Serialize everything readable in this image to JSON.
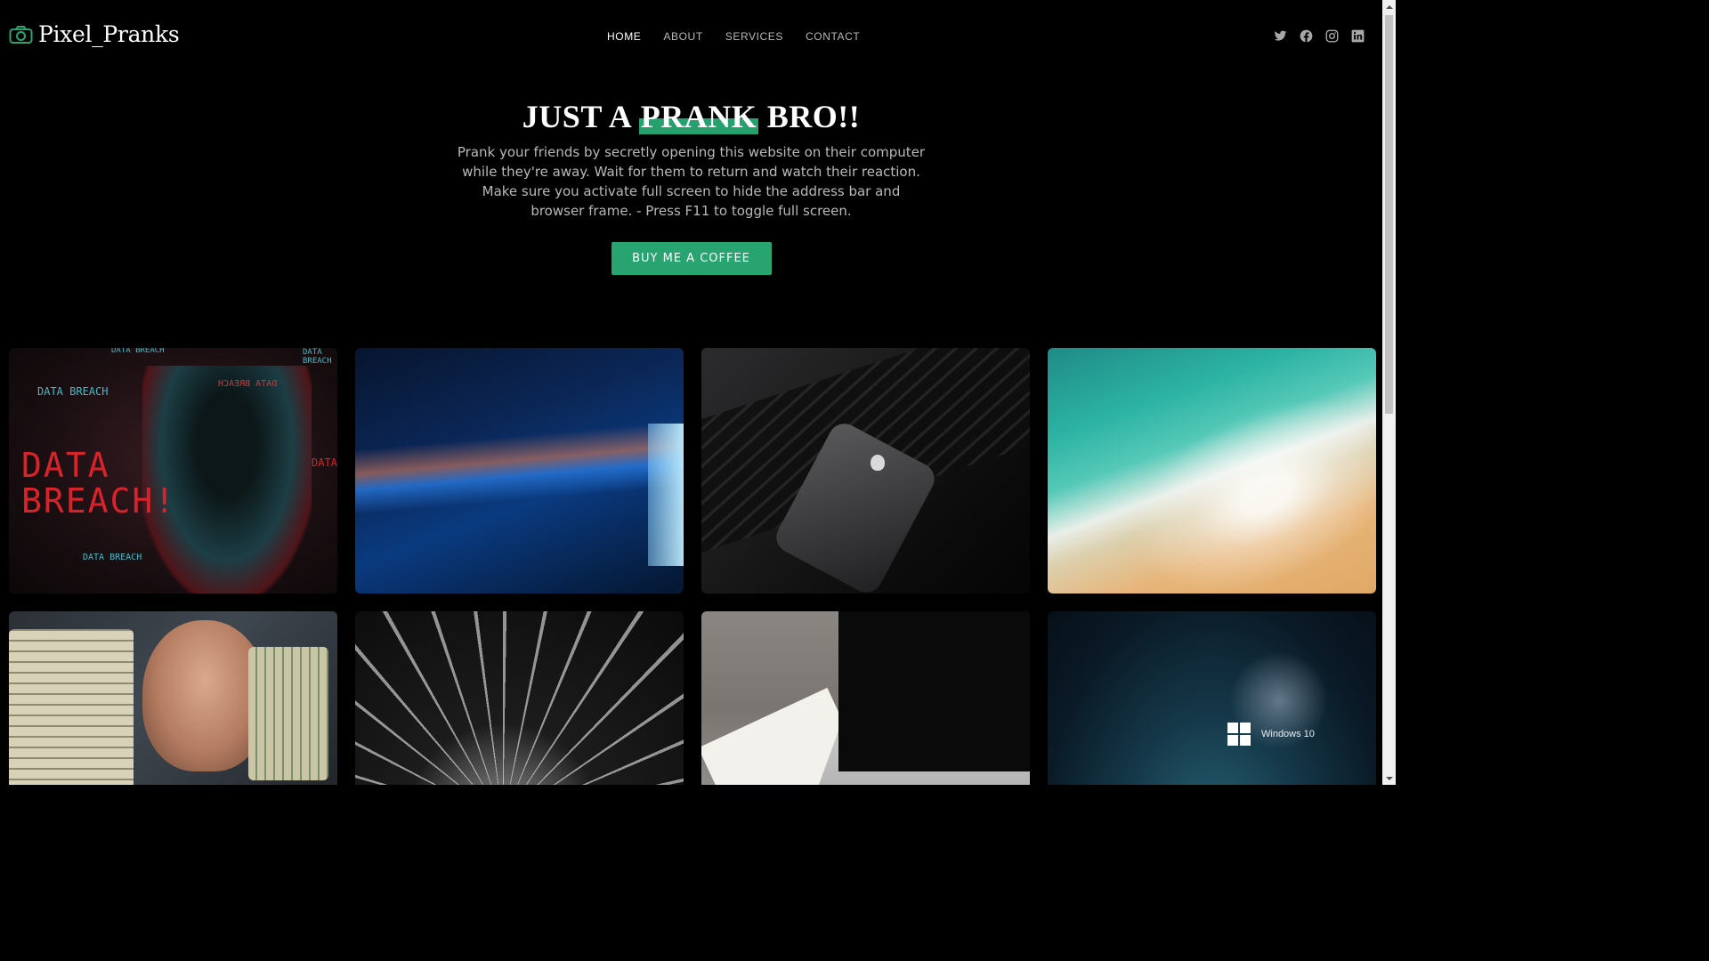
{
  "header": {
    "logo_text": "Pixel_Pranks",
    "logo_icon": "camera-icon",
    "nav": [
      {
        "label": "HOME",
        "active": true
      },
      {
        "label": "ABOUT",
        "active": false
      },
      {
        "label": "SERVICES",
        "active": false
      },
      {
        "label": "CONTACT",
        "active": false
      }
    ],
    "social_icons": [
      "twitter-icon",
      "facebook-icon",
      "instagram-icon",
      "linkedin-icon"
    ]
  },
  "hero": {
    "title_before": "JUST A ",
    "title_highlight": "PRANK",
    "title_after": " BRO!!",
    "description": "Prank your friends by secretly opening this website on their computer while they're away. Wait for them to return and watch their reaction. Make sure you activate full screen to hide the address bar and browser frame. - Press F11 to toggle full screen.",
    "cta_label": "BUY ME A COFFEE"
  },
  "gallery": {
    "tile1": {
      "big_text": "DATA\nBREACH!",
      "label": "DATA BREACH",
      "label_small": "DATA BREACH",
      "label_red": "DATA",
      "label_mirror": "DATA BREACH",
      "label_top": "DATA BREACH",
      "label_top_left": "DATA BREACH"
    },
    "tile8": {
      "text": "Windows 10"
    }
  },
  "colors": {
    "accent": "#27a46f",
    "background": "#000000",
    "nav_inactive": "#b7b7b7"
  }
}
